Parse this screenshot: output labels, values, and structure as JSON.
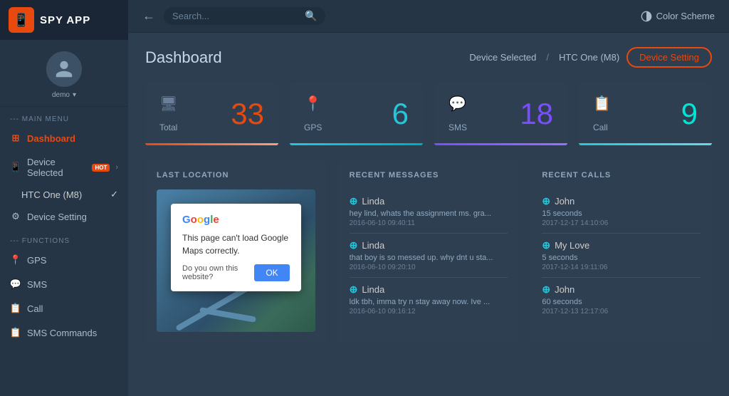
{
  "app": {
    "name": "SPY APP",
    "logo_emoji": "📱"
  },
  "user": {
    "name": "demo"
  },
  "sidebar": {
    "section_main": "--- MAIN MENU",
    "section_functions": "--- FUNCTIONS",
    "items_main": [
      {
        "label": "Dashboard",
        "icon": "dashboard",
        "active": true
      },
      {
        "label": "Device Selected",
        "badge": "HOT",
        "icon": "device",
        "active_menu": true
      },
      {
        "label": "HTC One (M8)",
        "checked": true
      },
      {
        "label": "Device Setting",
        "icon": "gear"
      }
    ],
    "items_functions": [
      {
        "label": "GPS",
        "icon": "gps"
      },
      {
        "label": "SMS",
        "icon": "sms"
      },
      {
        "label": "Call",
        "icon": "call"
      },
      {
        "label": "SMS Commands",
        "icon": "sms-cmd"
      }
    ]
  },
  "topbar": {
    "search_placeholder": "Search...",
    "color_scheme_label": "Color Scheme",
    "back_icon": "←"
  },
  "header": {
    "title": "Dashboard",
    "breadcrumb": "Device Selected",
    "breadcrumb_sep": "/",
    "device_name": "HTC One (M8)",
    "device_setting_btn": "Device Setting"
  },
  "stats": [
    {
      "label": "Total",
      "value": "33",
      "color_class": "orange",
      "icon": "monitor"
    },
    {
      "label": "GPS",
      "value": "6",
      "color_class": "teal",
      "icon": "pin"
    },
    {
      "label": "SMS",
      "value": "18",
      "color_class": "purple",
      "icon": "chat"
    },
    {
      "label": "Call",
      "value": "9",
      "color_class": "cyan",
      "icon": "doc"
    }
  ],
  "panels": {
    "location": {
      "title": "LAST LOCATION",
      "dialog": {
        "logo": "Google",
        "message": "This page can't load Google Maps correctly.",
        "question": "Do you own this website?",
        "ok_btn": "OK"
      }
    },
    "messages": {
      "title": "RECENT MESSAGES",
      "items": [
        {
          "sender": "Linda",
          "text": "hey lind, whats the assignment ms. gra...",
          "time": "2016-06-10 09:40:11"
        },
        {
          "sender": "Linda",
          "text": "that boy is so messed up. why dnt u sta...",
          "time": "2016-06-10 09:20:10"
        },
        {
          "sender": "Linda",
          "text": "ldk tbh, imma try n stay away now. Ive ...",
          "time": "2016-06-10 09:16:12"
        }
      ]
    },
    "calls": {
      "title": "RECENT CALLS",
      "items": [
        {
          "sender": "John",
          "duration": "15 seconds",
          "time": "2017-12-17 14:10:06"
        },
        {
          "sender": "My Love",
          "duration": "5 seconds",
          "time": "2017-12-14 19:11:06"
        },
        {
          "sender": "John",
          "duration": "60 seconds",
          "time": "2017-12-13 12:17:06"
        }
      ]
    }
  }
}
